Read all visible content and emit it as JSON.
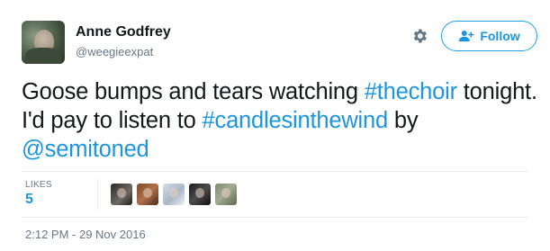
{
  "author": {
    "display_name": "Anne Godfrey",
    "screen_name": "@weegieexpat"
  },
  "actions": {
    "follow_label": "Follow",
    "gear_icon": "gear-icon",
    "follow_icon": "add-user-icon"
  },
  "tweet": {
    "segments": [
      {
        "text": "Goose bumps and tears watching ",
        "link": false
      },
      {
        "text": "#thechoir",
        "link": true
      },
      {
        "text": " tonight. I'd pay to listen to ",
        "link": false
      },
      {
        "text": "#candlesinthewind",
        "link": true
      },
      {
        "text": " by ",
        "link": false
      },
      {
        "text": "@semitoned",
        "link": true
      }
    ]
  },
  "stats": {
    "likes_label": "LIKES",
    "likes_count": "5"
  },
  "likers_count": 5,
  "timestamp": "2:12 PM - 29 Nov 2016",
  "colors": {
    "link": "#1b95e0",
    "follow_border": "#1da1f2",
    "muted": "#657786",
    "text": "#14171a"
  }
}
